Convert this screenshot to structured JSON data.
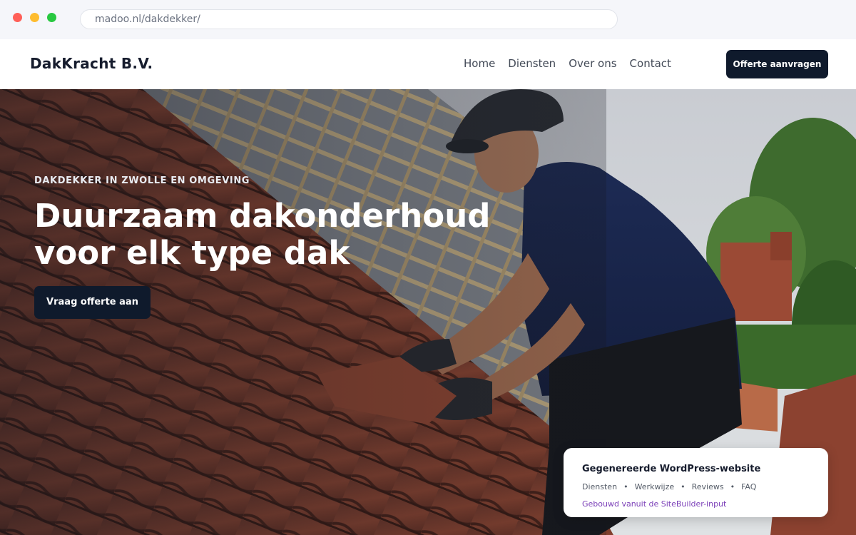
{
  "browser": {
    "url": "madoo.nl/dakdekker/"
  },
  "header": {
    "logo": "DakKracht B.V.",
    "nav": [
      "Home",
      "Diensten",
      "Over ons",
      "Contact"
    ],
    "cta_label": "Offerte aanvragen"
  },
  "hero": {
    "eyebrow": "DAKDEKKER IN ZWOLLE EN OMGEVING",
    "title": "Duurzaam dakonderhoud voor elk type dak",
    "button_label": "Vraag offerte aan"
  },
  "card": {
    "title": "Gegenereerde WordPress-website",
    "links": [
      "Diensten",
      "Werkwijze",
      "Reviews",
      "FAQ"
    ],
    "separator": "•",
    "footnote": "Gebouwd vanuit de SiteBuilder-input"
  },
  "colors": {
    "primary_dark": "#0f1a2c",
    "accent_purple": "#7b3fb8",
    "traffic_red": "#ff5f57",
    "traffic_yellow": "#febc2e",
    "traffic_green": "#28c840"
  }
}
